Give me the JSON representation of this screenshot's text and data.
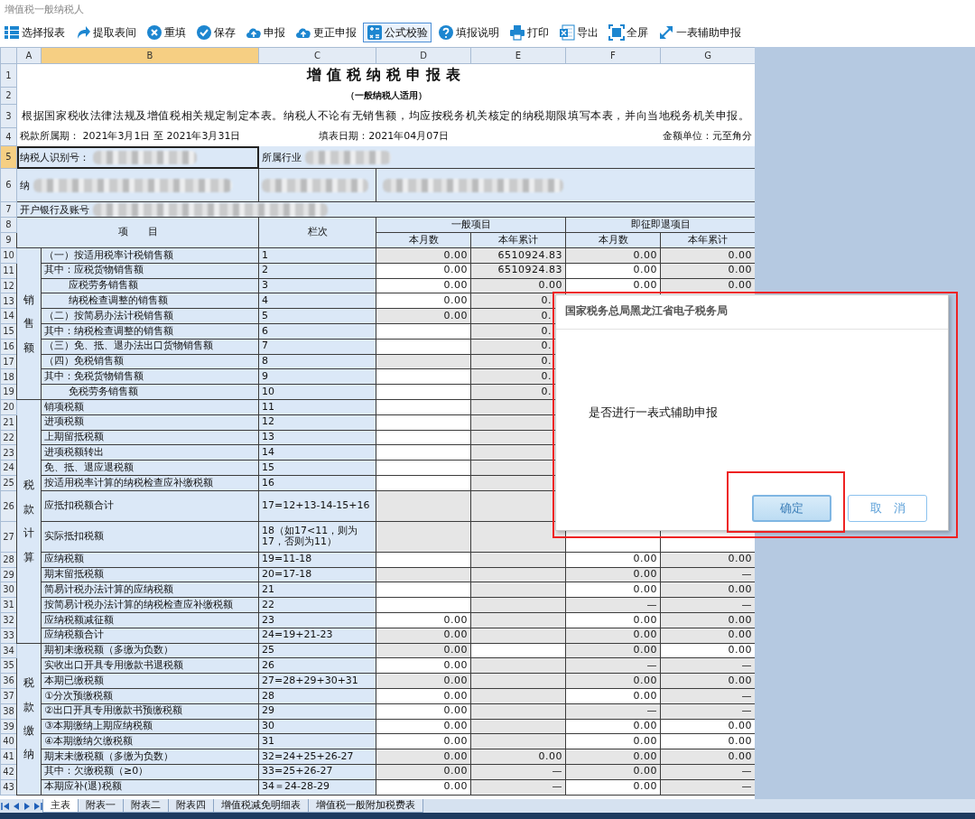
{
  "window": {
    "title": "增值税一般纳税人"
  },
  "toolbar": [
    {
      "label": "选择报表",
      "selected": false
    },
    {
      "label": "提取表间",
      "selected": false
    },
    {
      "label": "重填",
      "selected": false
    },
    {
      "label": "保存",
      "selected": false
    },
    {
      "label": "申报",
      "selected": false
    },
    {
      "label": "更正申报",
      "selected": false
    },
    {
      "label": "公式校验",
      "selected": true
    },
    {
      "label": "填报说明",
      "selected": false
    },
    {
      "label": "打印",
      "selected": false
    },
    {
      "label": "导出",
      "selected": false
    },
    {
      "label": "全屏",
      "selected": false
    },
    {
      "label": "一表辅助申报",
      "selected": false
    }
  ],
  "column_headers": [
    {
      "label": "A",
      "selected": false
    },
    {
      "label": "B",
      "selected": true
    },
    {
      "label": "C",
      "selected": false
    },
    {
      "label": "D",
      "selected": false
    },
    {
      "label": "E",
      "selected": false
    },
    {
      "label": "F",
      "selected": false
    },
    {
      "label": "G",
      "selected": false
    }
  ],
  "row_headers": [
    {
      "label": "1",
      "selected": false
    },
    {
      "label": "2",
      "selected": false
    },
    {
      "label": "3",
      "selected": false
    },
    {
      "label": "4",
      "selected": false
    },
    {
      "label": "5",
      "selected": true
    },
    {
      "label": "6",
      "selected": false
    },
    {
      "label": "7",
      "selected": false
    },
    {
      "label": "8",
      "selected": false
    },
    {
      "label": "9",
      "selected": false
    },
    {
      "label": "10",
      "selected": false
    },
    {
      "label": "11",
      "selected": false
    },
    {
      "label": "12",
      "selected": false
    },
    {
      "label": "13",
      "selected": false
    },
    {
      "label": "14",
      "selected": false
    },
    {
      "label": "15",
      "selected": false
    },
    {
      "label": "16",
      "selected": false
    },
    {
      "label": "17",
      "selected": false
    },
    {
      "label": "18",
      "selected": false
    },
    {
      "label": "19",
      "selected": false
    },
    {
      "label": "20",
      "selected": false
    },
    {
      "label": "21",
      "selected": false
    },
    {
      "label": "22",
      "selected": false
    },
    {
      "label": "23",
      "selected": false
    },
    {
      "label": "24",
      "selected": false
    },
    {
      "label": "25",
      "selected": false
    },
    {
      "label": "26",
      "selected": false
    },
    {
      "label": "27",
      "selected": false
    },
    {
      "label": "28",
      "selected": false
    },
    {
      "label": "29",
      "selected": false
    },
    {
      "label": "30",
      "selected": false
    },
    {
      "label": "31",
      "selected": false
    },
    {
      "label": "32",
      "selected": false
    },
    {
      "label": "33",
      "selected": false
    },
    {
      "label": "34",
      "selected": false
    },
    {
      "label": "35",
      "selected": false
    },
    {
      "label": "36",
      "selected": false
    },
    {
      "label": "37",
      "selected": false
    },
    {
      "label": "38",
      "selected": false
    },
    {
      "label": "39",
      "selected": false
    },
    {
      "label": "40",
      "selected": false
    },
    {
      "label": "41",
      "selected": false
    },
    {
      "label": "42",
      "selected": false
    },
    {
      "label": "43",
      "selected": false
    }
  ],
  "form": {
    "title": "增值税纳税申报表",
    "subtitle": "（一般纳税人适用）",
    "statement": "根据国家税收法律法规及增值税相关规定制定本表。纳税人不论有无销售额，均应按税务机关核定的纳税期限填写本表，并向当地税务机关申报。",
    "period": "税款所属期： 2021年3月1日 至 2021年3月31日",
    "fill_date": "填表日期：2021年04月07日",
    "unit": "金额单位：元至角分",
    "taxpayer_id": {
      "label": "纳税人识别号：",
      "selected": true
    },
    "industry": {
      "label": "所属行业"
    },
    "name": {
      "label": "纳"
    },
    "bank": {
      "label": "开户银行及账号"
    },
    "head_item": "项　　目",
    "head_code": "栏次",
    "group_general": "一般项目",
    "group_refund": "即征即退项目",
    "col_month": [
      "本月数",
      "本月数"
    ],
    "col_year": [
      "本年累计",
      "本年累计"
    ]
  },
  "sections": [
    {
      "label": "销售额",
      "rows": [
        {
          "item": "（一）按适用税率计税销售额",
          "code": "1",
          "indented": false,
          "cells": [
            {
              "value": "0.00",
              "locked": true
            },
            {
              "value": "6510924.83",
              "locked": true
            },
            {
              "value": "0.00",
              "locked": true
            },
            {
              "value": "0.00",
              "locked": true
            }
          ]
        },
        {
          "item": "其中：应税货物销售额",
          "code": "2",
          "indented": false,
          "cells": [
            {
              "value": "0.00",
              "locked": false
            },
            {
              "value": "6510924.83",
              "locked": true
            },
            {
              "value": "0.00",
              "locked": false
            },
            {
              "value": "0.00",
              "locked": true
            }
          ]
        },
        {
          "item": "应税劳务销售额",
          "code": "3",
          "indented": true,
          "cells": [
            {
              "value": "0.00",
              "locked": false
            },
            {
              "value": "0.00",
              "locked": true
            },
            {
              "value": "0.00",
              "locked": false
            },
            {
              "value": "0.00",
              "locked": true
            }
          ]
        },
        {
          "item": "纳税检查调整的销售额",
          "code": "4",
          "indented": true,
          "cells": [
            {
              "value": "0.00",
              "locked": false
            },
            {
              "value": "0.",
              "locked": true,
              "clipped": true
            },
            null,
            null
          ]
        },
        {
          "item": "（二）按简易办法计税销售额",
          "code": "5",
          "indented": false,
          "cells": [
            {
              "value": "0.00",
              "locked": true
            },
            {
              "value": "0.",
              "locked": true,
              "clipped": true
            },
            null,
            null
          ]
        },
        {
          "item": "其中：纳税检查调整的销售额",
          "code": "6",
          "indented": false,
          "cells": [
            {
              "locked": false
            },
            {
              "value": "0.",
              "locked": true,
              "clipped": true
            },
            null,
            null
          ]
        },
        {
          "item": "（三）免、抵、退办法出口货物销售额",
          "code": "7",
          "indented": false,
          "cells": [
            {
              "locked": false
            },
            {
              "value": "0.",
              "locked": true,
              "clipped": true
            },
            null,
            null
          ]
        },
        {
          "item": "（四）免税销售额",
          "code": "8",
          "indented": false,
          "cells": [
            {
              "locked": true
            },
            {
              "value": "0.",
              "locked": true,
              "clipped": true
            },
            null,
            null
          ]
        },
        {
          "item": "其中：免税货物销售额",
          "code": "9",
          "indented": false,
          "cells": [
            {
              "locked": false
            },
            {
              "value": "0.",
              "locked": true,
              "clipped": true
            },
            null,
            null
          ]
        },
        {
          "item": "免税劳务销售额",
          "code": "10",
          "indented": true,
          "cells": [
            {
              "locked": false
            },
            {
              "value": "0.",
              "locked": true,
              "clipped": true
            },
            null,
            null
          ]
        }
      ]
    },
    {
      "label": "税款计算",
      "rows": [
        {
          "item": "销项税额",
          "code": "11",
          "indented": false,
          "cells": [
            {
              "locked": false
            },
            {
              "locked": true
            },
            null,
            null
          ]
        },
        {
          "item": "进项税额",
          "code": "12",
          "indented": false,
          "cells": [
            {
              "locked": false
            },
            {
              "locked": true
            },
            null,
            null
          ]
        },
        {
          "item": "上期留抵税额",
          "code": "13",
          "indented": false,
          "cells": [
            {
              "locked": false
            },
            {
              "locked": true
            },
            null,
            null
          ]
        },
        {
          "item": "进项税额转出",
          "code": "14",
          "indented": false,
          "cells": [
            {
              "locked": false
            },
            {
              "locked": true
            },
            null,
            null
          ]
        },
        {
          "item": "免、抵、退应退税额",
          "code": "15",
          "indented": false,
          "cells": [
            {
              "locked": false
            },
            {
              "locked": true
            },
            null,
            null
          ]
        },
        {
          "item": "按适用税率计算的纳税检查应补缴税额",
          "code": "16",
          "indented": false,
          "cells": [
            {
              "locked": false
            },
            {
              "locked": true
            },
            null,
            null
          ]
        },
        {
          "item": "应抵扣税额合计",
          "code": "17=12+13-14-15+16",
          "indented": false,
          "cells": [
            {
              "locked": true
            },
            {
              "locked": true
            },
            null,
            null
          ]
        },
        {
          "item": "实际抵扣税额",
          "code": "18（如17<11，则为17，否则为11）",
          "indented": false,
          "cells": [
            {
              "locked": true
            },
            {
              "locked": true
            },
            null,
            null
          ]
        },
        {
          "item": "应纳税额",
          "code": "19=11-18",
          "indented": false,
          "cells": [
            {
              "locked": false
            },
            {
              "locked": true
            },
            {
              "value": "0.00",
              "locked": false
            },
            {
              "value": "0.00",
              "locked": true
            }
          ]
        },
        {
          "item": "期末留抵税额",
          "code": "20=17-18",
          "indented": false,
          "cells": [
            {
              "locked": true
            },
            {
              "locked": true
            },
            {
              "value": "0.00",
              "locked": true
            },
            {
              "value": "—",
              "locked": true
            }
          ]
        },
        {
          "item": "简易计税办法计算的应纳税额",
          "code": "21",
          "indented": false,
          "cells": [
            {
              "locked": false
            },
            {
              "locked": true
            },
            {
              "value": "0.00",
              "locked": false
            },
            {
              "value": "0.00",
              "locked": true
            }
          ]
        },
        {
          "item": "按简易计税办法计算的纳税检查应补缴税额",
          "code": "22",
          "indented": false,
          "cells": [
            {
              "locked": false
            },
            {
              "locked": true
            },
            {
              "value": "—",
              "locked": true
            },
            {
              "value": "—",
              "locked": true
            }
          ]
        },
        {
          "item": "应纳税额减征额",
          "code": "23",
          "indented": false,
          "cells": [
            {
              "value": "0.00",
              "locked": false
            },
            {
              "locked": true
            },
            {
              "value": "0.00",
              "locked": false
            },
            {
              "value": "0.00",
              "locked": true
            }
          ]
        },
        {
          "item": "应纳税额合计",
          "code": "24=19+21-23",
          "indented": false,
          "cells": [
            {
              "value": "0.00",
              "locked": true
            },
            {
              "locked": true
            },
            {
              "value": "0.00",
              "locked": true
            },
            {
              "value": "0.00",
              "locked": true
            }
          ]
        }
      ]
    },
    {
      "label": "税款缴纳",
      "rows": [
        {
          "item": "期初未缴税额（多缴为负数）",
          "code": "25",
          "indented": false,
          "cells": [
            {
              "value": "0.00",
              "locked": true
            },
            {
              "locked": false
            },
            {
              "value": "0.00",
              "locked": true
            },
            {
              "value": "0.00",
              "locked": false
            }
          ]
        },
        {
          "item": "实收出口开具专用缴款书退税额",
          "code": "26",
          "indented": false,
          "cells": [
            {
              "value": "0.00",
              "locked": false
            },
            {
              "locked": true
            },
            {
              "value": "—",
              "locked": true
            },
            {
              "value": "—",
              "locked": true
            }
          ]
        },
        {
          "item": "本期已缴税额",
          "code": "27=28+29+30+31",
          "indented": false,
          "cells": [
            {
              "value": "0.00",
              "locked": true
            },
            {
              "locked": true
            },
            {
              "value": "0.00",
              "locked": true
            },
            {
              "value": "0.00",
              "locked": true
            }
          ]
        },
        {
          "item": "①分次预缴税额",
          "code": "28",
          "indented": false,
          "cells": [
            {
              "value": "0.00",
              "locked": false
            },
            {
              "locked": true
            },
            {
              "value": "0.00",
              "locked": false
            },
            {
              "value": "—",
              "locked": true
            }
          ]
        },
        {
          "item": "②出口开具专用缴款书预缴税额",
          "code": "29",
          "indented": false,
          "cells": [
            {
              "value": "0.00",
              "locked": false
            },
            {
              "locked": true
            },
            {
              "value": "—",
              "locked": true
            },
            {
              "value": "—",
              "locked": true
            }
          ]
        },
        {
          "item": "③本期缴纳上期应纳税额",
          "code": "30",
          "indented": false,
          "cells": [
            {
              "value": "0.00",
              "locked": false
            },
            {
              "locked": true
            },
            {
              "value": "0.00",
              "locked": false
            },
            {
              "value": "0.00",
              "locked": false
            }
          ]
        },
        {
          "item": "④本期缴纳欠缴税额",
          "code": "31",
          "indented": false,
          "cells": [
            {
              "value": "0.00",
              "locked": false
            },
            {
              "locked": true
            },
            {
              "value": "0.00",
              "locked": false
            },
            {
              "value": "0.00",
              "locked": false
            }
          ]
        },
        {
          "item": "期末未缴税额（多缴为负数）",
          "code": "32=24+25+26-27",
          "indented": false,
          "cells": [
            {
              "value": "0.00",
              "locked": true
            },
            {
              "value": "0.00",
              "locked": true
            },
            {
              "value": "0.00",
              "locked": true
            },
            {
              "value": "0.00",
              "locked": true
            }
          ]
        },
        {
          "item": "其中：欠缴税额（≥0）",
          "code": "33=25+26-27",
          "indented": false,
          "cells": [
            {
              "value": "0.00",
              "locked": true
            },
            {
              "value": "—",
              "locked": true
            },
            {
              "value": "0.00",
              "locked": true
            },
            {
              "value": "—",
              "locked": true
            }
          ]
        },
        {
          "item": "本期应补(退)税额",
          "code": "34＝24-28-29",
          "indented": false,
          "cells": [
            {
              "value": "0.00",
              "locked": false
            },
            {
              "value": "—",
              "locked": true
            },
            {
              "value": "0.00",
              "locked": false
            },
            {
              "value": "—",
              "locked": true
            }
          ]
        }
      ]
    }
  ],
  "sheet_tabs": [
    {
      "label": "主表",
      "selected": true
    },
    {
      "label": "附表一",
      "selected": false
    },
    {
      "label": "附表二",
      "selected": false
    },
    {
      "label": "附表四",
      "selected": false
    },
    {
      "label": "增值税减免明细表",
      "selected": false
    },
    {
      "label": "增值税一般附加税费表",
      "selected": false
    }
  ],
  "dialog": {
    "title": "国家税务总局黑龙江省电子税务局",
    "message": "是否进行一表式辅助申报",
    "buttons": [
      {
        "label": "确定",
        "focused": true
      },
      {
        "label": "取　消",
        "focused": false
      }
    ]
  }
}
